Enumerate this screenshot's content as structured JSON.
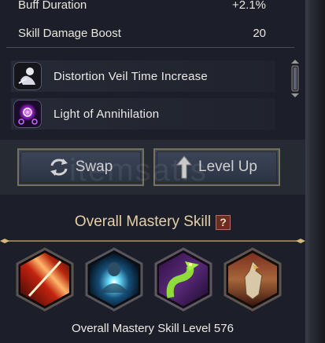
{
  "stats": [
    {
      "label": "Buff Duration",
      "value": "+2.1%"
    },
    {
      "label": "Skill Damage Boost",
      "value": "20"
    }
  ],
  "skills": [
    {
      "label": "Distortion Veil Time Increase",
      "icon": "distortion-veil-icon"
    },
    {
      "label": "Light of Annihilation",
      "icon": "annihilation-orb-icon"
    }
  ],
  "buttons": {
    "swap_label": "Swap",
    "level_up_label": "Level Up"
  },
  "watermark": "itemsatis",
  "mastery": {
    "title": "Overall Mastery Skill",
    "help": "?",
    "level_text": "Overall Mastery Skill Level 576",
    "icons": [
      "fire-slash-icon",
      "spirit-orb-icon",
      "serpent-icon",
      "eagle-icon"
    ]
  },
  "colors": {
    "panel_bg": "#1c1f29",
    "gold": "#b8945a",
    "title_gold": "#e4cfa8",
    "help_red": "#6b2c22"
  }
}
